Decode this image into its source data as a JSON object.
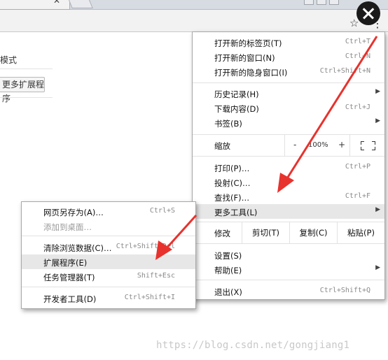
{
  "page": {
    "mode_text": "模式",
    "extension_button": "更多扩展程序"
  },
  "menu": {
    "new_tab": {
      "label": "打开新的标签页(T)",
      "shortcut": "Ctrl+T"
    },
    "new_window": {
      "label": "打开新的窗口(N)",
      "shortcut": "Ctrl+N"
    },
    "incognito": {
      "label": "打开新的隐身窗口(I)",
      "shortcut": "Ctrl+Shift+N"
    },
    "history": {
      "label": "历史记录(H)"
    },
    "downloads": {
      "label": "下载内容(D)",
      "shortcut": "Ctrl+J"
    },
    "bookmarks": {
      "label": "书签(B)"
    },
    "zoom": {
      "label": "缩放",
      "minus": "-",
      "value": "100%",
      "plus": "+"
    },
    "print": {
      "label": "打印(P)…",
      "shortcut": "Ctrl+P"
    },
    "cast": {
      "label": "投射(C)…"
    },
    "find": {
      "label": "查找(F)…",
      "shortcut": "Ctrl+F"
    },
    "more_tools": {
      "label": "更多工具(L)"
    },
    "edit": {
      "label": "修改",
      "cut": "剪切(T)",
      "copy": "复制(C)",
      "paste": "粘贴(P)"
    },
    "settings": {
      "label": "设置(S)"
    },
    "help": {
      "label": "帮助(E)"
    },
    "exit": {
      "label": "退出(X)",
      "shortcut": "Ctrl+Shift+Q"
    }
  },
  "submenu": {
    "save_as": {
      "label": "网页另存为(A)…",
      "shortcut": "Ctrl+S"
    },
    "add_to_desktop": {
      "label": "添加到桌面…"
    },
    "clear_data": {
      "label": "清除浏览数据(C)…",
      "shortcut": "Ctrl+Shift+Del"
    },
    "extensions": {
      "label": "扩展程序(E)"
    },
    "task_manager": {
      "label": "任务管理器(T)",
      "shortcut": "Shift+Esc"
    },
    "dev_tools": {
      "label": "开发者工具(D)",
      "shortcut": "Ctrl+Shift+I"
    }
  },
  "watermark": "https://blog.csdn.net/gongjiang1",
  "icons": {
    "close": "close-icon",
    "star": "star-icon",
    "menu": "menu-dots-icon",
    "fullscreen": "fullscreen-icon",
    "submenu_arrow": "chevron-right-icon"
  },
  "colors": {
    "highlight": "#e7e7e7",
    "annotation_arrow": "#e8322d",
    "overlay_close": "#1a1a1a"
  }
}
